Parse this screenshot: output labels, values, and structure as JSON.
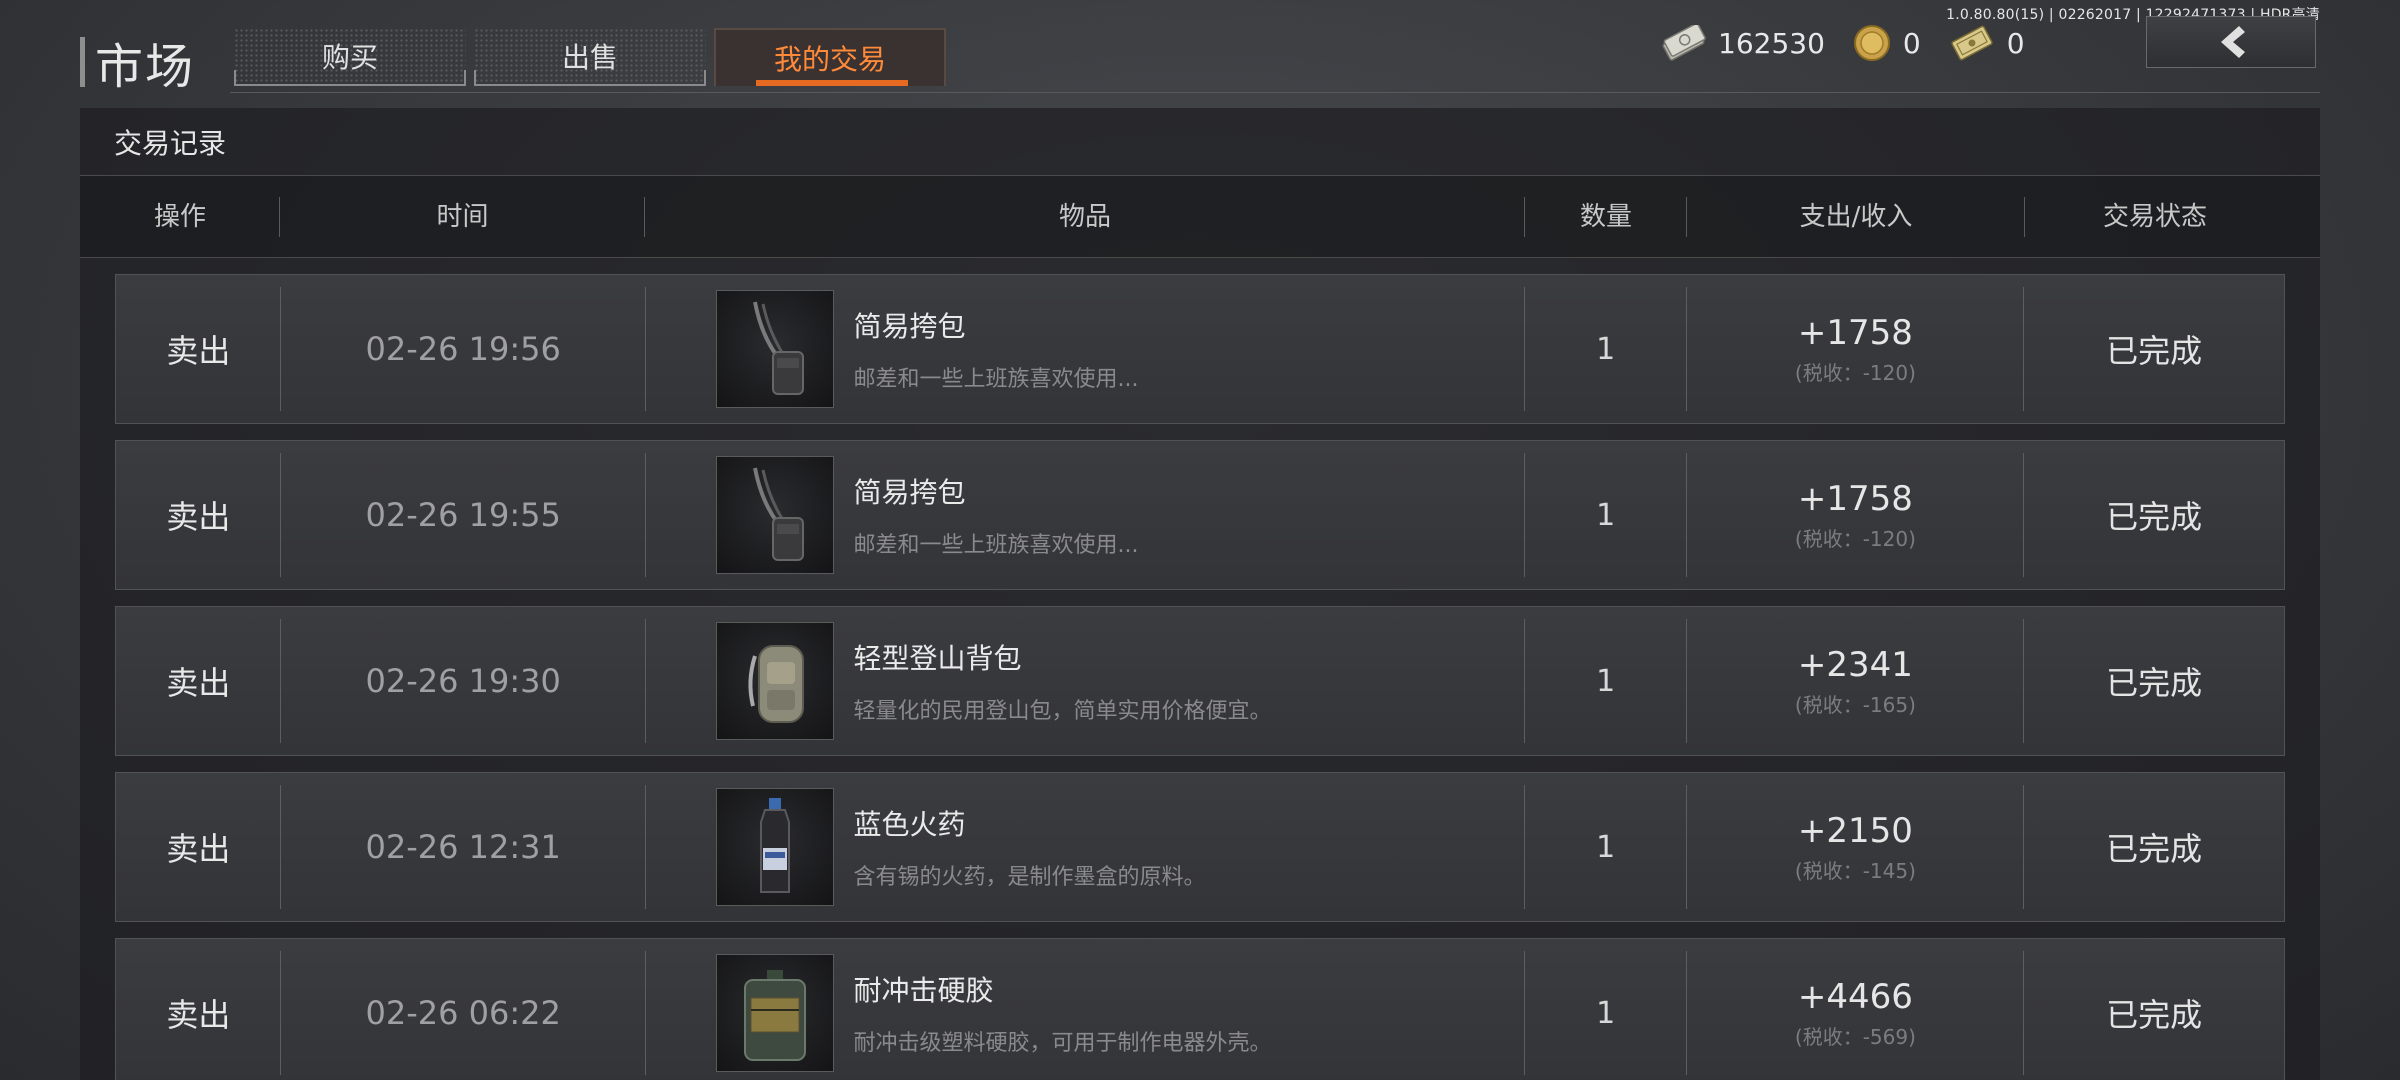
{
  "version_text": "1.0.80.80(15) | 02262017 | 12292471373 | HDR高清",
  "header": {
    "title": "市场",
    "tabs": [
      {
        "label": "购买",
        "active": false
      },
      {
        "label": "出售",
        "active": false
      },
      {
        "label": "我的交易",
        "active": true
      }
    ],
    "currency": {
      "cash": "162530",
      "gold_coin": "0",
      "voucher": "0"
    }
  },
  "panel": {
    "title": "交易记录",
    "columns": [
      "操作",
      "时间",
      "物品",
      "数量",
      "支出/收入",
      "交易状态"
    ]
  },
  "records": [
    {
      "op": "卖出",
      "time": "02-26 19:56",
      "item_name": "简易挎包",
      "item_desc": "邮差和一些上班族喜欢使用...",
      "qty": "1",
      "amount": "+1758",
      "tax": "(税收：-120)",
      "status": "已完成",
      "icon": "shoulder-bag-icon"
    },
    {
      "op": "卖出",
      "time": "02-26 19:55",
      "item_name": "简易挎包",
      "item_desc": "邮差和一些上班族喜欢使用...",
      "qty": "1",
      "amount": "+1758",
      "tax": "(税收：-120)",
      "status": "已完成",
      "icon": "shoulder-bag-icon"
    },
    {
      "op": "卖出",
      "time": "02-26 19:30",
      "item_name": "轻型登山背包",
      "item_desc": "轻量化的民用登山包，简单实用价格便宜。",
      "qty": "1",
      "amount": "+2341",
      "tax": "(税收：-165)",
      "status": "已完成",
      "icon": "backpack-icon"
    },
    {
      "op": "卖出",
      "time": "02-26 12:31",
      "item_name": "蓝色火药",
      "item_desc": "含有锡的火药，是制作墨盒的原料。",
      "qty": "1",
      "amount": "+2150",
      "tax": "(税收：-145)",
      "status": "已完成",
      "icon": "powder-bottle-icon"
    },
    {
      "op": "卖出",
      "time": "02-26 06:22",
      "item_name": "耐冲击硬胶",
      "item_desc": "耐冲击级塑料硬胶，可用于制作电器外壳。",
      "qty": "1",
      "amount": "+4466",
      "tax": "(税收：-569)",
      "status": "已完成",
      "icon": "glue-canister-icon"
    }
  ],
  "colors": {
    "accent": "#e76a22",
    "accent_text": "#ff8a3a",
    "background": "#3a3c40"
  }
}
